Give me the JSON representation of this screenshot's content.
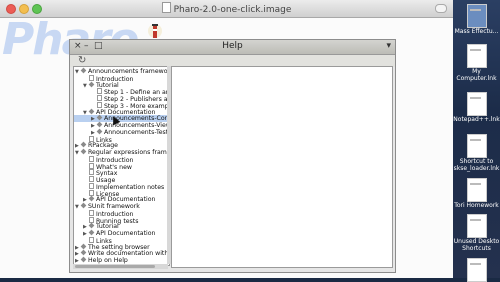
{
  "window": {
    "title": "Pharo-2.0-one-click.image"
  },
  "logo": {
    "text": "Pharo"
  },
  "help": {
    "title": "Help",
    "close_glyph": "×",
    "collapse_glyph": "–",
    "maximize_glyph": "□",
    "menu_glyph": "▾",
    "refresh_glyph": "↻"
  },
  "tree": [
    {
      "label": "Announcements framework",
      "level": 0,
      "type": "book",
      "arrow": "▼"
    },
    {
      "label": "Introduction",
      "level": 1,
      "type": "page",
      "arrow": ""
    },
    {
      "label": "Tutorial",
      "level": 1,
      "type": "book",
      "arrow": "▼"
    },
    {
      "label": "Step 1 - Define an annou",
      "level": 2,
      "type": "page",
      "arrow": ""
    },
    {
      "label": "Step 2 - Publishers and",
      "level": 2,
      "type": "page",
      "arrow": ""
    },
    {
      "label": "Step 3 - More examples",
      "level": 2,
      "type": "page",
      "arrow": ""
    },
    {
      "label": "API Documentation",
      "level": 1,
      "type": "book",
      "arrow": "▼"
    },
    {
      "label": "Announcements-Core",
      "level": 2,
      "type": "book",
      "arrow": "▶",
      "selected": true
    },
    {
      "label": "Announcements-View",
      "level": 2,
      "type": "book",
      "arrow": "▶"
    },
    {
      "label": "Announcements-Tests-C",
      "level": 2,
      "type": "book",
      "arrow": "▶"
    },
    {
      "label": "Links",
      "level": 1,
      "type": "page",
      "arrow": ""
    },
    {
      "label": "RPackage",
      "level": 0,
      "type": "book",
      "arrow": "▶"
    },
    {
      "label": "Regular expressions framew",
      "level": 0,
      "type": "book",
      "arrow": "▼"
    },
    {
      "label": "Introduction",
      "level": 1,
      "type": "page",
      "arrow": ""
    },
    {
      "label": "What's new",
      "level": 1,
      "type": "page",
      "arrow": ""
    },
    {
      "label": "Syntax",
      "level": 1,
      "type": "page",
      "arrow": ""
    },
    {
      "label": "Usage",
      "level": 1,
      "type": "page",
      "arrow": ""
    },
    {
      "label": "Implementation notes",
      "level": 1,
      "type": "page",
      "arrow": ""
    },
    {
      "label": "License",
      "level": 1,
      "type": "page",
      "arrow": ""
    },
    {
      "label": "API Documentation",
      "level": 1,
      "type": "book",
      "arrow": "▶"
    },
    {
      "label": "SUnit framework",
      "level": 0,
      "type": "book",
      "arrow": "▼"
    },
    {
      "label": "Introduction",
      "level": 1,
      "type": "page",
      "arrow": ""
    },
    {
      "label": "Running tests",
      "level": 1,
      "type": "page",
      "arrow": ""
    },
    {
      "label": "Tutorial",
      "level": 1,
      "type": "book",
      "arrow": "▶"
    },
    {
      "label": "API Documentation",
      "level": 1,
      "type": "book",
      "arrow": "▶"
    },
    {
      "label": "Links",
      "level": 1,
      "type": "page",
      "arrow": ""
    },
    {
      "label": "The setting browser",
      "level": 0,
      "type": "book",
      "arrow": "▶"
    },
    {
      "label": "Write documentation with w",
      "level": 0,
      "type": "book",
      "arrow": "▶"
    },
    {
      "label": "Help on Help",
      "level": 0,
      "type": "book",
      "arrow": "▶"
    }
  ],
  "desktop": [
    {
      "label": "Mass Effectu...",
      "type": "img"
    },
    {
      "label": "My Computer.lnk",
      "type": "doc"
    },
    {
      "label": "Notepad++.lnk",
      "type": "doc"
    },
    {
      "label": "Shortcut to skse_loader.lnk",
      "type": "doc"
    },
    {
      "label": "Tori Homework",
      "type": "doc"
    },
    {
      "label": "Unused Deskto Shortcuts",
      "type": "doc"
    },
    {
      "label": "",
      "type": "doc"
    }
  ]
}
